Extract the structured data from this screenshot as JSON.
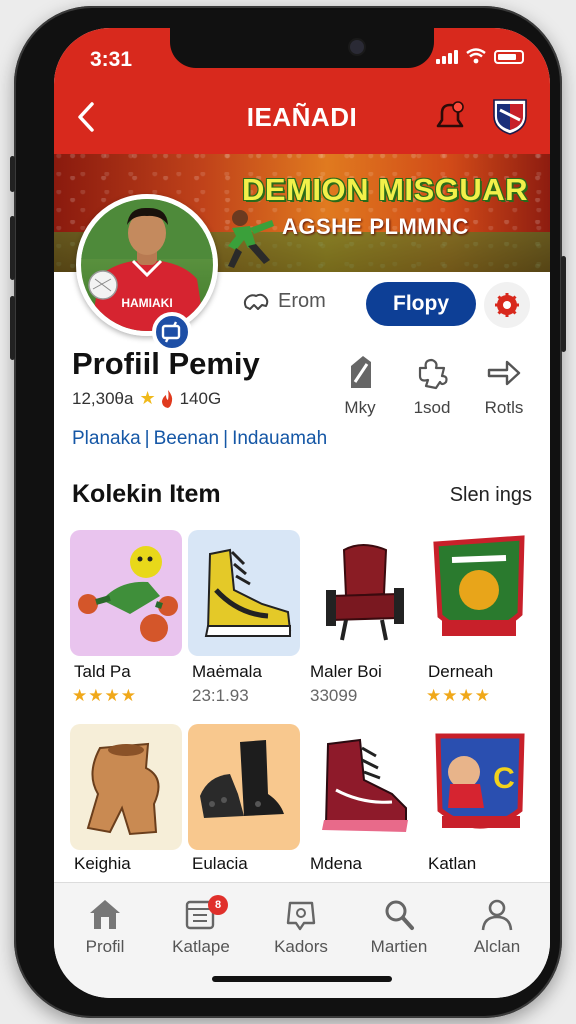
{
  "status_bar": {
    "time": "3:31"
  },
  "header": {
    "title": "IEAÑADI"
  },
  "banner": {
    "title": "DEMION MISGUAR",
    "subtitle": "AGSHE PLMMNC",
    "jersey_text": "HAMIAKI"
  },
  "actions": {
    "follow_label": "Erom",
    "primary_button": "Flopy"
  },
  "profile": {
    "name": "Profiil Pemiy",
    "stat_a": "12,30θa",
    "stat_b": "140G",
    "tags": [
      "Planaka",
      "Beenan",
      "Indauamah"
    ]
  },
  "quick_actions": [
    {
      "label": "Mky",
      "icon": "edit-icon"
    },
    {
      "label": "1sod",
      "icon": "puzzle-icon"
    },
    {
      "label": "Rotls",
      "icon": "share-icon"
    }
  ],
  "collection": {
    "title": "Kolekin Item",
    "link": "Slen ings",
    "items": [
      {
        "name": "Tald Pa",
        "sub": "",
        "stars": "★★★★",
        "bg": "#e9c4ee"
      },
      {
        "name": "Maėmala",
        "sub": "23:1.93",
        "stars": "",
        "bg": "#d8e6f6"
      },
      {
        "name": "Maler Boi",
        "sub": "33099",
        "stars": "",
        "bg": "#ffffff"
      },
      {
        "name": "Derneah",
        "sub": "",
        "stars": "★★★★",
        "bg": "#ffffff"
      },
      {
        "name": "Keighia",
        "sub": "",
        "stars": "",
        "bg": "#f6eed8"
      },
      {
        "name": "Eulacia",
        "sub": "",
        "stars": "",
        "bg": "#f8c88e"
      },
      {
        "name": "Mdena",
        "sub": "",
        "stars": "",
        "bg": "#ffffff"
      },
      {
        "name": "Katlan",
        "sub": "",
        "stars": "",
        "bg": "#ffffff"
      }
    ]
  },
  "bottom_nav": [
    {
      "label": "Profil",
      "icon": "home-icon"
    },
    {
      "label": "Katlape",
      "icon": "calendar-icon",
      "badge": "8"
    },
    {
      "label": "Kadors",
      "icon": "tag-icon"
    },
    {
      "label": "Martien",
      "icon": "search-icon"
    },
    {
      "label": "Alclan",
      "icon": "user-icon"
    }
  ],
  "colors": {
    "brand_red": "#d8291d",
    "primary_blue": "#0d3f96",
    "link_blue": "#1557a6",
    "star": "#f0a81a"
  }
}
